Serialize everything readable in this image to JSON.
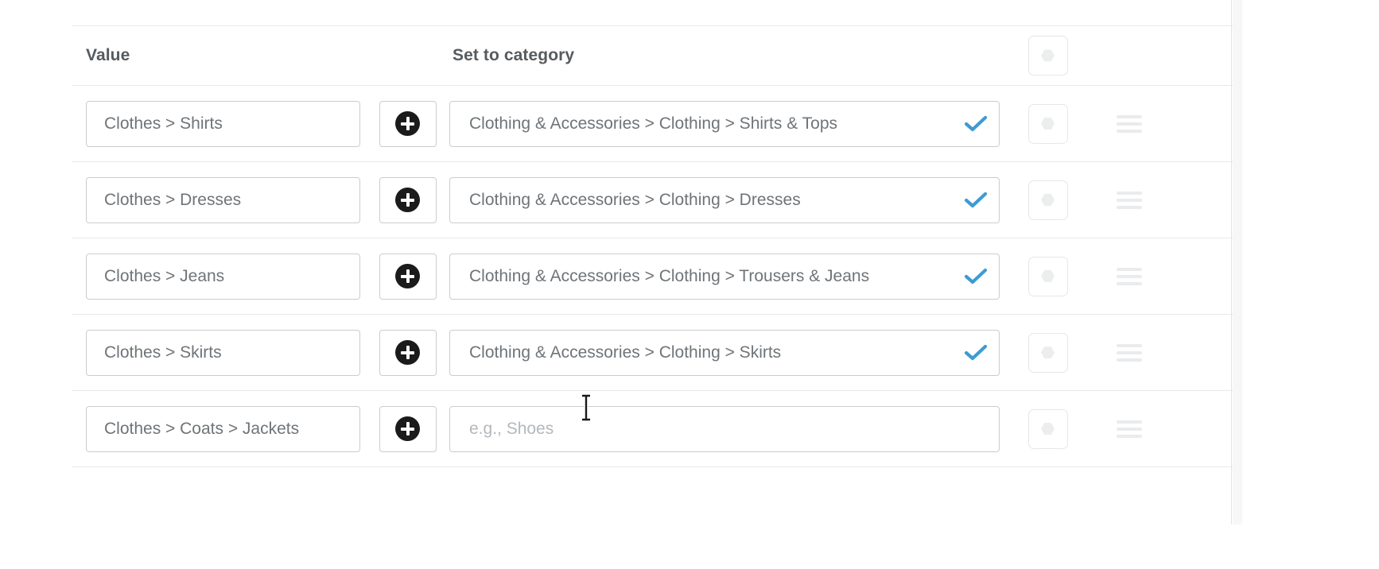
{
  "table": {
    "columns": [
      {
        "key": "value",
        "label": "Value"
      },
      {
        "key": "category",
        "label": "Set to category"
      }
    ],
    "header_toggle": {
      "icon": "dot-hexagon-icon"
    },
    "rows": [
      {
        "value": "Clothes > Shirts",
        "category": "Clothing & Accessories > Clothing > Shirts & Tops",
        "category_placeholder": "e.g., Shoes",
        "confirmed": true,
        "add_icon": "plus-circle-icon",
        "toggle_icon": "dot-hexagon-icon",
        "drag_icon": "drag-handle-icon"
      },
      {
        "value": "Clothes > Dresses",
        "category": "Clothing & Accessories > Clothing > Dresses",
        "category_placeholder": "e.g., Shoes",
        "confirmed": true,
        "add_icon": "plus-circle-icon",
        "toggle_icon": "dot-hexagon-icon",
        "drag_icon": "drag-handle-icon"
      },
      {
        "value": "Clothes > Jeans",
        "category": "Clothing & Accessories > Clothing > Trousers & Jeans",
        "category_placeholder": "e.g., Shoes",
        "confirmed": true,
        "add_icon": "plus-circle-icon",
        "toggle_icon": "dot-hexagon-icon",
        "drag_icon": "drag-handle-icon"
      },
      {
        "value": "Clothes > Skirts",
        "category": "Clothing & Accessories > Clothing > Skirts",
        "category_placeholder": "e.g., Shoes",
        "confirmed": true,
        "add_icon": "plus-circle-icon",
        "toggle_icon": "dot-hexagon-icon",
        "drag_icon": "drag-handle-icon"
      },
      {
        "value": "Clothes > Coats > Jackets",
        "category": "",
        "category_placeholder": "e.g., Shoes",
        "confirmed": false,
        "add_icon": "plus-circle-icon",
        "toggle_icon": "dot-hexagon-icon",
        "drag_icon": "drag-handle-icon"
      }
    ]
  },
  "colors": {
    "check_blue": "#3e9bd3",
    "text": "#6f7478",
    "header_text": "#555b5f",
    "placeholder": "#b3b8bc",
    "border": "#c9cdd0",
    "row_divider": "#e8e8e8"
  },
  "cursor": {
    "type": "text-ibeam-cursor"
  }
}
